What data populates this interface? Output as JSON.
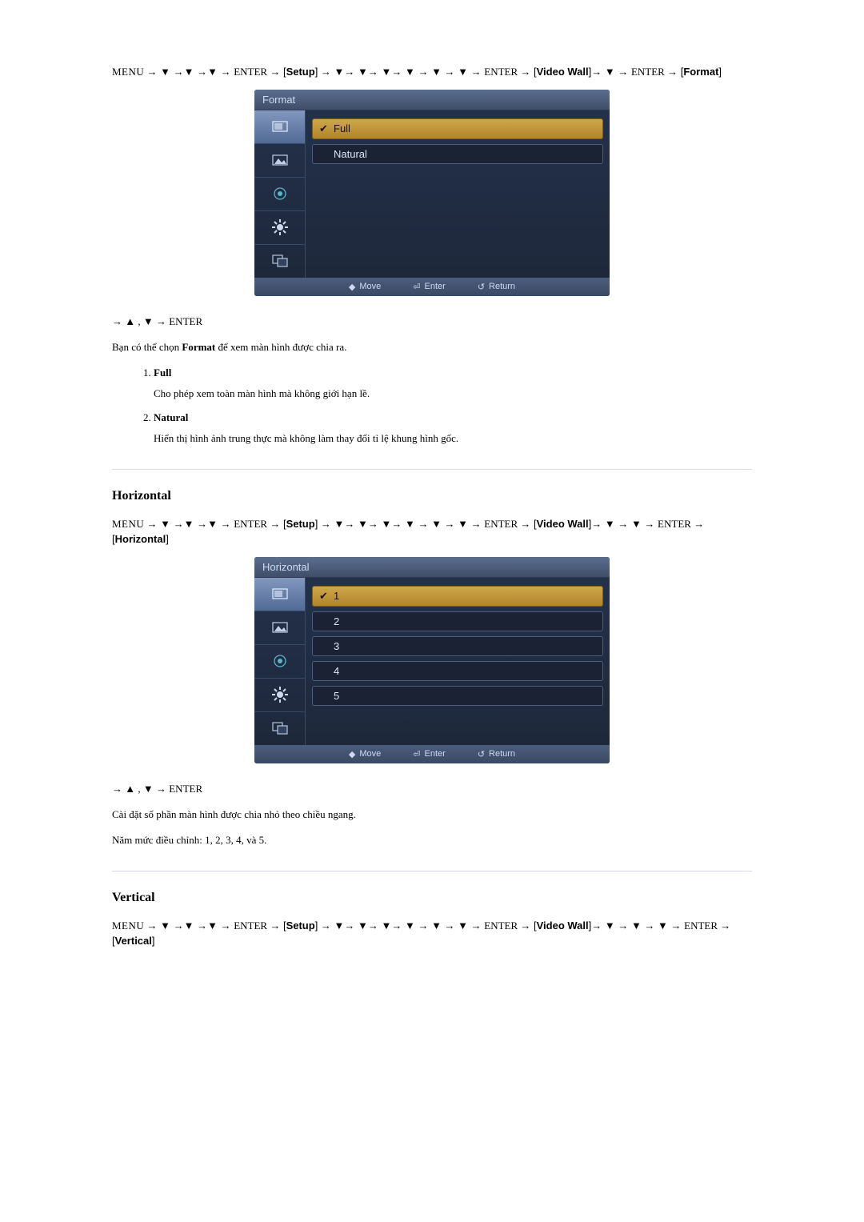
{
  "nav1": {
    "menu": "MENU",
    "enter": "ENTER",
    "setup": "Setup",
    "videowall": "Video Wall",
    "format": "Format"
  },
  "osd_format": {
    "title": "Format",
    "items": [
      "Full",
      "Natural"
    ],
    "selected_index": 0,
    "footer": {
      "move": "Move",
      "enter": "Enter",
      "return": "Return"
    }
  },
  "nav_post": "→ ▲ , ▼ → ENTER",
  "body1": {
    "pre": "Bạn có thể chọn ",
    "bold": "Format",
    "post": " để xem màn hình được chia ra."
  },
  "defs_format": [
    {
      "term": "Full",
      "desc": "Cho phép xem toàn màn hình mà không giới hạn lề."
    },
    {
      "term": "Natural",
      "desc": "Hiển thị hình ảnh trung thực mà không làm thay đổi tỉ lệ khung hình gốc."
    }
  ],
  "section_horizontal": {
    "heading": "Horizontal",
    "nav": {
      "menu": "MENU",
      "enter": "ENTER",
      "setup": "Setup",
      "videowall": "Video Wall",
      "final": "Horizontal"
    },
    "osd": {
      "title": "Horizontal",
      "items": [
        "1",
        "2",
        "3",
        "4",
        "5"
      ],
      "selected_index": 0,
      "footer": {
        "move": "Move",
        "enter": "Enter",
        "return": "Return"
      }
    },
    "body": "Cài đặt số phần màn hình được chia nhỏ theo chiều ngang.",
    "levels": "Năm mức điều chỉnh: 1, 2, 3, 4, và 5."
  },
  "section_vertical": {
    "heading": "Vertical",
    "nav": {
      "menu": "MENU",
      "enter": "ENTER",
      "setup": "Setup",
      "videowall": "Video Wall",
      "final": "Vertical"
    }
  },
  "icons": {
    "input": "input-icon",
    "picture": "picture-icon",
    "sound": "sound-icon",
    "setup": "setup-icon",
    "multi": "multi-icon"
  }
}
